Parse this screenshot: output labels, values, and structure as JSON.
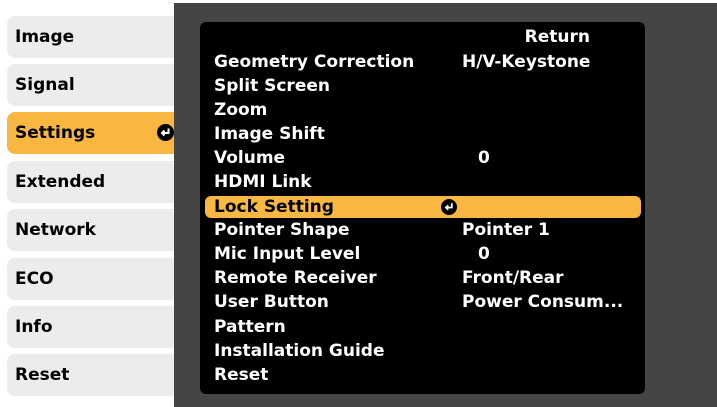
{
  "sidebar": {
    "tabs": [
      {
        "label": "Image"
      },
      {
        "label": "Signal"
      },
      {
        "label": "Settings"
      },
      {
        "label": "Extended"
      },
      {
        "label": "Network"
      },
      {
        "label": "ECO"
      },
      {
        "label": "Info"
      },
      {
        "label": "Reset"
      }
    ]
  },
  "menu": {
    "return_label": "Return",
    "items": [
      {
        "label": "Geometry Correction",
        "value": "H/V-Keystone"
      },
      {
        "label": "Split Screen",
        "value": ""
      },
      {
        "label": "Zoom",
        "value": ""
      },
      {
        "label": "Image Shift",
        "value": ""
      },
      {
        "label": "Volume",
        "value": "0"
      },
      {
        "label": "HDMI Link",
        "value": ""
      },
      {
        "label": "Lock Setting",
        "value": ""
      },
      {
        "label": "Pointer Shape",
        "value": "Pointer 1"
      },
      {
        "label": "Mic Input Level",
        "value": "0"
      },
      {
        "label": "Remote Receiver",
        "value": "Front/Rear"
      },
      {
        "label": "User Button",
        "value": "Power Consum..."
      },
      {
        "label": "Pattern",
        "value": ""
      },
      {
        "label": "Installation Guide",
        "value": ""
      },
      {
        "label": "Reset",
        "value": ""
      }
    ]
  },
  "colors": {
    "highlight": "#f7b741",
    "panel": "#454545",
    "tab_bg": "#ececec"
  },
  "icons": {
    "enter": "enter-icon"
  }
}
